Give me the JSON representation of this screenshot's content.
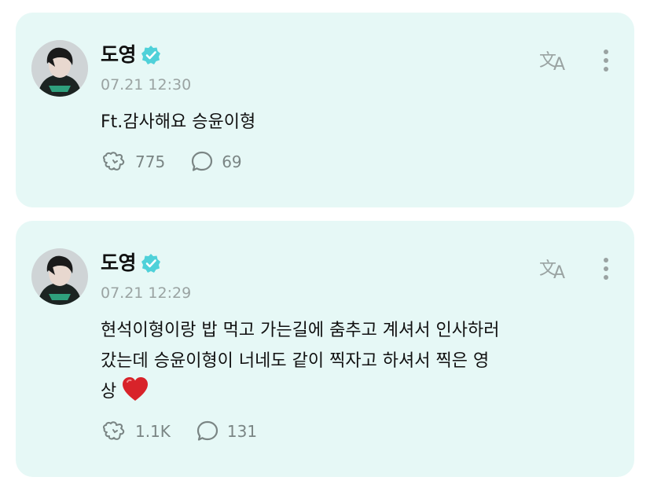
{
  "posts": [
    {
      "author": "도영",
      "verified": true,
      "timestamp": "07.21 12:30",
      "text": "Ft.감사해요 승윤이형",
      "reactions": "775",
      "comments": "69"
    },
    {
      "author": "도영",
      "verified": true,
      "timestamp": "07.21 12:29",
      "text": "현석이형이랑 밥 먹고 가는길에 춤추고 계셔서 인사하러\n갔는데 승윤이형이 너네도 같이 찍자고 하셔서 찍은 영\n상",
      "emoji": "heart",
      "reactions": "1.1K",
      "comments": "131"
    }
  ],
  "icons": {
    "verified": "verified-badge-icon",
    "translate": "translate-icon",
    "more": "more-vertical-icon",
    "reaction": "reaction-icon",
    "comment": "comment-bubble-icon"
  },
  "colors": {
    "card_background": "#e6f8f6",
    "verified_badge": "#4fd1d9",
    "icon_gray": "#9aa3a2",
    "heart": "#d8232a"
  }
}
